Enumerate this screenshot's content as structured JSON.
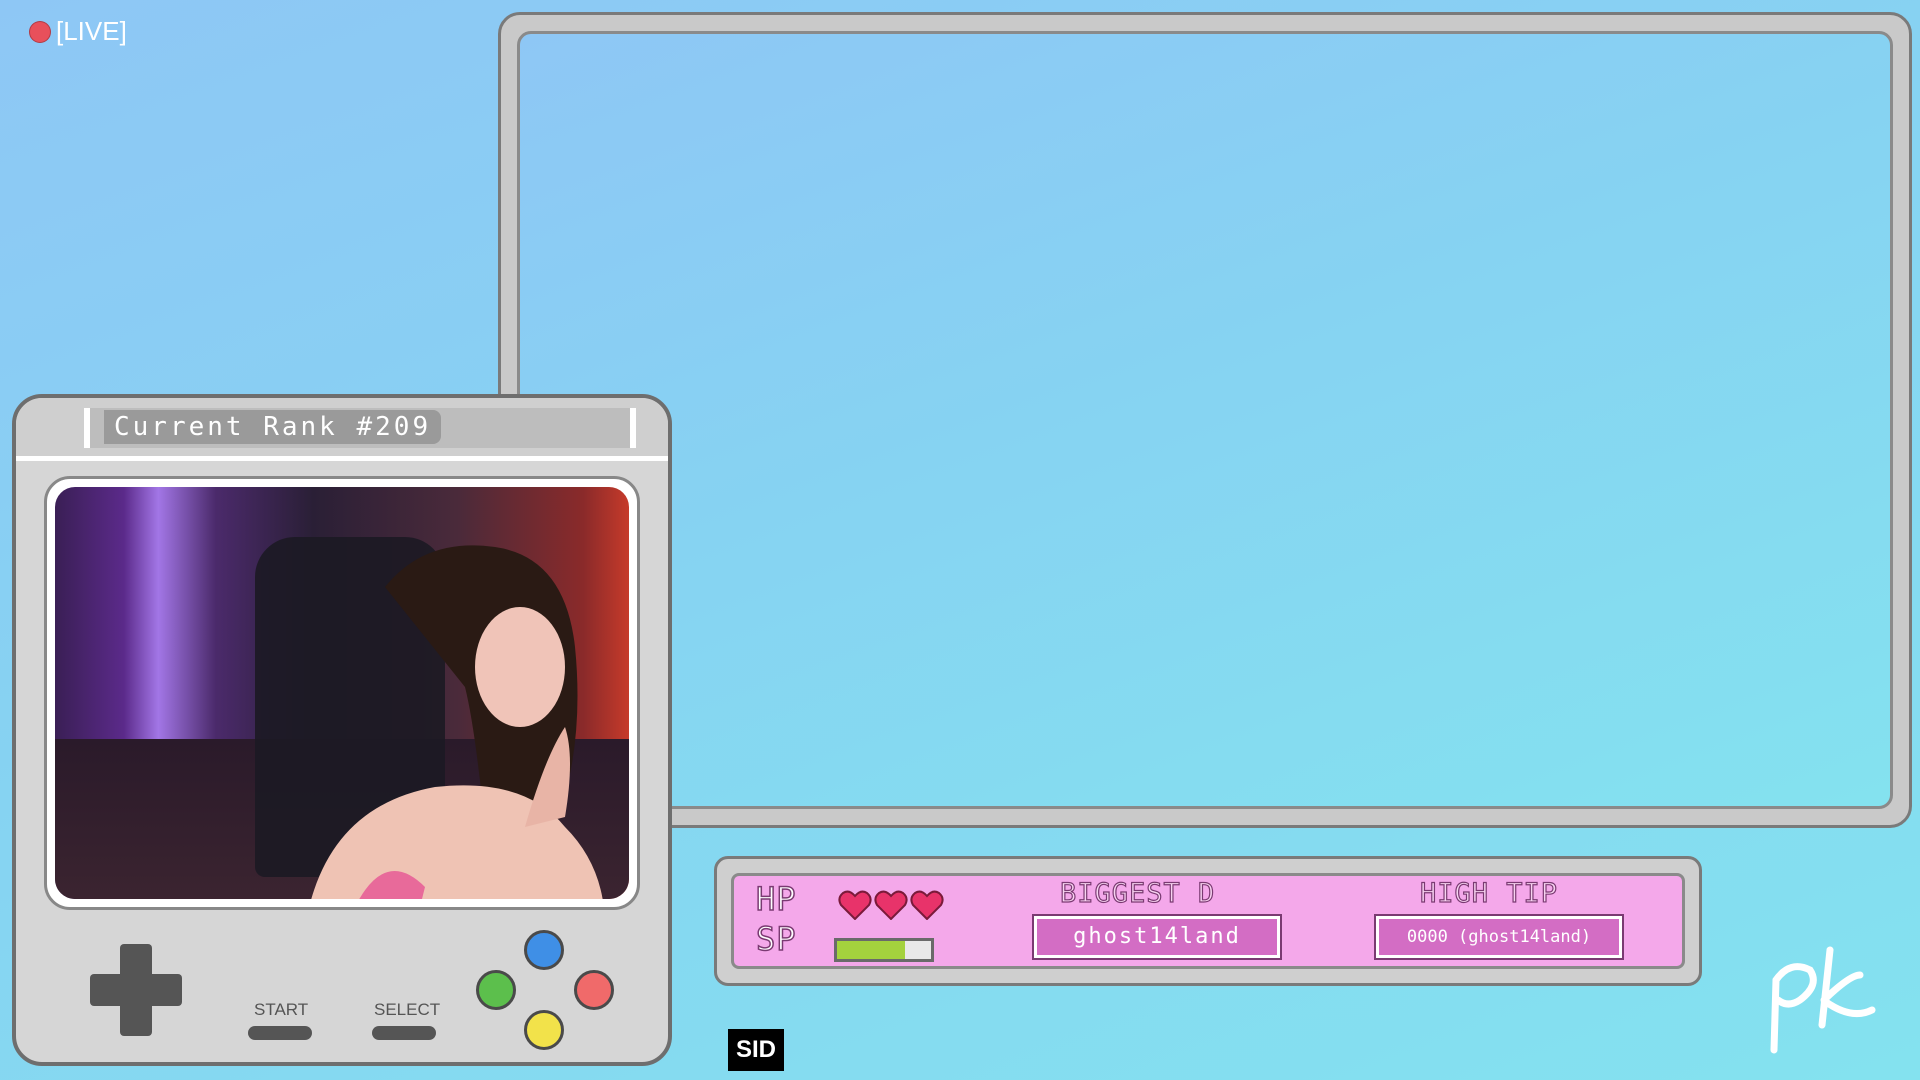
{
  "live": {
    "label": "[LIVE]",
    "dot_color": "#e8505b"
  },
  "console": {
    "rank_label": "Current Rank #209",
    "start_label": "START",
    "select_label": "SELECT",
    "buttons": [
      {
        "name": "blue-button",
        "color": "#3f8fe6"
      },
      {
        "name": "green-button",
        "color": "#5cbf4c"
      },
      {
        "name": "red-button",
        "color": "#f06a6a"
      },
      {
        "name": "yellow-button",
        "color": "#f2e24a"
      }
    ]
  },
  "hud": {
    "hp_label": "HP",
    "sp_label": "SP",
    "hearts": 3,
    "sp_level": 0.72,
    "biggest_heading": "BIGGEST D",
    "biggest_value": "ghost14land",
    "high_tip_heading": "HIGH TIP",
    "high_tip_value": "0000 (ghost14land)"
  },
  "sid_tag": "SID",
  "logo_icon": "pk-logo"
}
